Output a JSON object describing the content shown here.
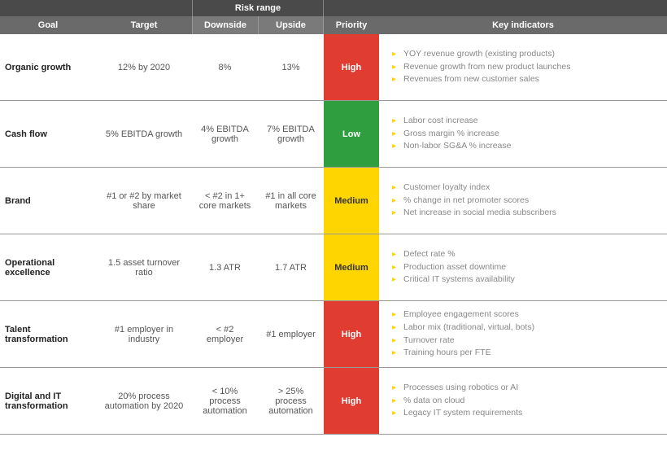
{
  "header": {
    "risk_range": "Risk range",
    "cols": {
      "goal": "Goal",
      "target": "Target",
      "downside": "Downside",
      "upside": "Upside",
      "priority": "Priority",
      "indicators": "Key indicators"
    }
  },
  "priority_colors": {
    "High": "#e03c31",
    "Low": "#2e9e3f",
    "Medium": "#ffd500"
  },
  "rows": [
    {
      "goal": "Organic growth",
      "target": "12% by 2020",
      "downside": "8%",
      "upside": "13%",
      "priority": "High",
      "indicators": [
        "YOY revenue growth (existing products)",
        "Revenue growth from new product launches",
        "Revenues from new customer sales"
      ]
    },
    {
      "goal": "Cash flow",
      "target": "5% EBITDA growth",
      "downside": "4% EBITDA growth",
      "upside": "7% EBITDA growth",
      "priority": "Low",
      "indicators": [
        "Labor cost increase",
        "Gross margin % increase",
        "Non-labor SG&A % increase"
      ]
    },
    {
      "goal": "Brand",
      "target": "#1 or #2 by market share",
      "downside": "< #2 in 1+ core markets",
      "upside": "#1 in all core markets",
      "priority": "Medium",
      "indicators": [
        "Customer loyalty index",
        "% change in net promoter scores",
        "Net increase in social media subscribers"
      ]
    },
    {
      "goal": "Operational excellence",
      "target": "1.5 asset turnover ratio",
      "downside": "1.3 ATR",
      "upside": "1.7 ATR",
      "priority": "Medium",
      "indicators": [
        "Defect rate %",
        "Production asset downtime",
        "Critical IT systems availability"
      ]
    },
    {
      "goal": "Talent transformation",
      "target": "#1 employer in industry",
      "downside": "< #2 employer",
      "upside": "#1 employer",
      "priority": "High",
      "indicators": [
        "Employee engagement scores",
        "Labor mix (traditional, virtual, bots)",
        "Turnover rate",
        "Training hours per FTE"
      ]
    },
    {
      "goal": "Digital and IT transformation",
      "target": "20% process automation by 2020",
      "downside": "< 10% process automation",
      "upside": "> 25% process automation",
      "priority": "High",
      "indicators": [
        "Processes using robotics or AI",
        "% data on cloud",
        "Legacy IT system requirements"
      ]
    }
  ]
}
